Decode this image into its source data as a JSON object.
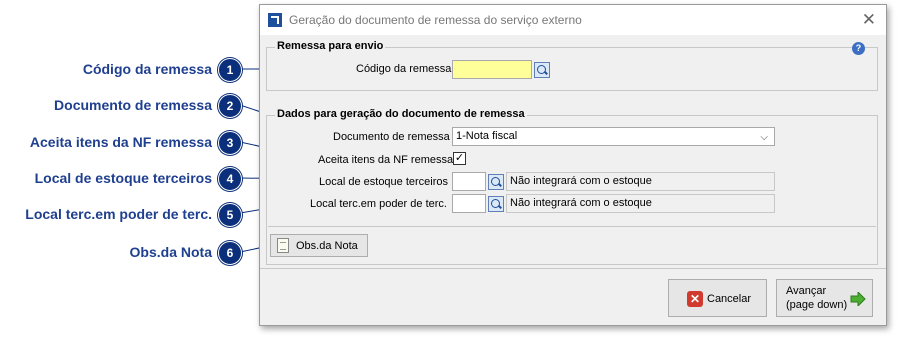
{
  "callouts": [
    {
      "num": "1",
      "label": "Código da remessa"
    },
    {
      "num": "2",
      "label": "Documento de remessa"
    },
    {
      "num": "3",
      "label": "Aceita itens da NF remessa"
    },
    {
      "num": "4",
      "label": "Local de estoque terceiros"
    },
    {
      "num": "5",
      "label": "Local terc.em poder de terc."
    },
    {
      "num": "6",
      "label": "Obs.da Nota"
    }
  ],
  "dialog": {
    "title": "Geração do documento de remessa do serviço externo",
    "close_icon": "close-icon",
    "help_icon": "help-icon",
    "group1": {
      "title": "Remessa para envio",
      "codigo_label": "Código da remessa",
      "codigo_value": ""
    },
    "group2": {
      "title": "Dados para geração do documento de remessa",
      "documento_label": "Documento de remessa",
      "documento_value": "1-Nota fiscal",
      "aceita_label": "Aceita itens da NF remessa",
      "aceita_checked": "✓",
      "local_estoque_label": "Local de estoque terceiros",
      "local_estoque_value": "",
      "local_estoque_desc": "Não integrará com o estoque",
      "local_terc_label": "Local terc.em poder de terc.",
      "local_terc_value": "",
      "local_terc_desc": "Não integrará com o estoque"
    },
    "obs_button": "Obs.da Nota",
    "cancel_button": "Cancelar",
    "next_button_line1": "Avançar",
    "next_button_line2": "(page down)",
    "colors": {
      "accent": "#0b2f7a",
      "label": "#1f3f8f",
      "yellow_field": "#ffff99"
    }
  }
}
